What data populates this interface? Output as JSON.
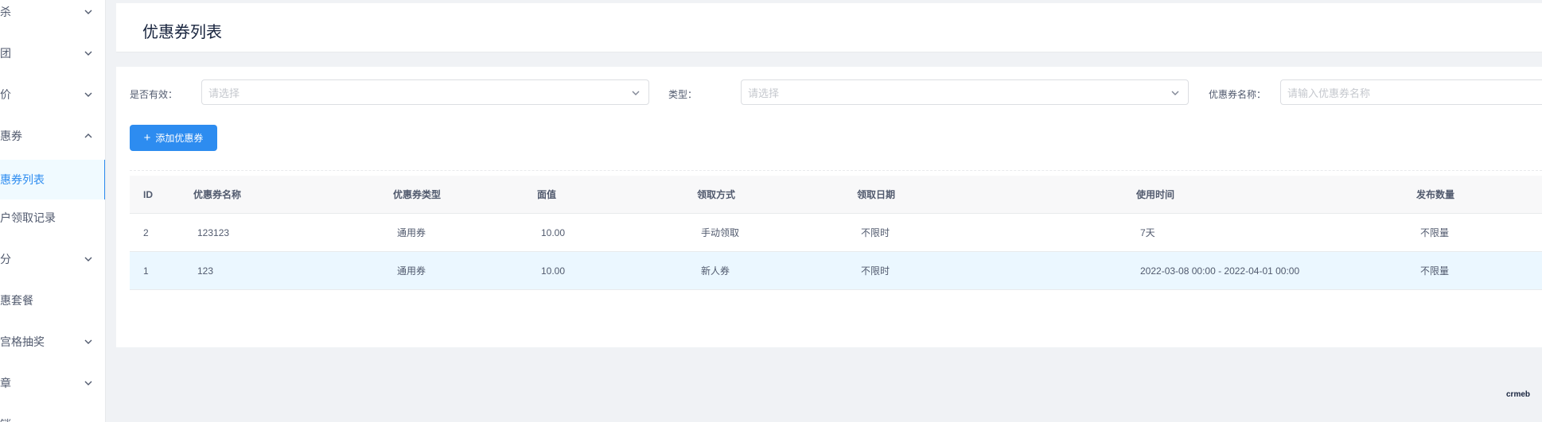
{
  "sidebar": {
    "items": [
      {
        "label": "秒杀",
        "expanded": false
      },
      {
        "label": "拼团",
        "expanded": false
      },
      {
        "label": "砍价",
        "expanded": false
      },
      {
        "label": "优惠券",
        "expanded": true
      },
      {
        "label": "优惠券列表",
        "active": true
      },
      {
        "label": "用户领取记录"
      },
      {
        "label": "积分",
        "expanded": false
      },
      {
        "label": "优惠套餐"
      },
      {
        "label": "九宫格抽奖",
        "expanded": false
      },
      {
        "label": "文章",
        "expanded": false
      },
      {
        "label": "分销"
      }
    ]
  },
  "header": {
    "title": "优惠券列表"
  },
  "filters": {
    "valid_label": "是否有效：",
    "valid_placeholder": "请选择",
    "type_label": "类型：",
    "type_placeholder": "请选择",
    "name_label": "优惠券名称：",
    "name_placeholder": "请输入优惠券名称"
  },
  "toolbar": {
    "add_label": "添加优惠券",
    "add_icon": "plus-icon"
  },
  "table": {
    "columns": [
      "ID",
      "优惠券名称",
      "优惠券类型",
      "面值",
      "领取方式",
      "领取日期",
      "使用时间",
      "发布数量"
    ],
    "rows": [
      {
        "id": "2",
        "name": "123123",
        "type": "通用券",
        "value": "10.00",
        "method": "手动领取",
        "date": "不限时",
        "use_time": "7天",
        "quantity": "不限量"
      },
      {
        "id": "1",
        "name": "123",
        "type": "通用券",
        "value": "10.00",
        "method": "新人券",
        "date": "不限时",
        "use_time": "2022-03-08 00:00 - 2022-04-01 00:00",
        "quantity": "不限量"
      }
    ]
  },
  "watermark": "crmeb",
  "colors": {
    "primary": "#2d8cf0",
    "hover_row": "#ebf7ff",
    "background": "#f0f2f5"
  }
}
